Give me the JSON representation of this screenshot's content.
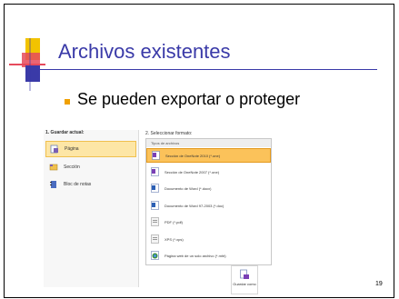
{
  "slide": {
    "title": "Archivos existentes",
    "bullet": "Se pueden exportar o proteger",
    "page_number": "19"
  },
  "dialog": {
    "left_header": "1. Guardar actual:",
    "left_items": [
      {
        "label": "Página",
        "icon": "page-icon",
        "selected": true
      },
      {
        "label": "Sección",
        "icon": "section-icon",
        "selected": false
      },
      {
        "label": "Bloc de notas",
        "icon": "notebook-icon",
        "selected": false
      }
    ],
    "right_header": "2. Seleccionar formato:",
    "list_header": "Tipos de archivos",
    "formats": [
      {
        "label": "Sección de OneNote 2010 (*.one)",
        "icon": "onenote-icon",
        "selected": true
      },
      {
        "label": "Sección de OneNote 2007 (*.one)",
        "icon": "onenote-icon",
        "selected": false
      },
      {
        "label": "Documento de Word (*.docx)",
        "icon": "word-icon",
        "selected": false
      },
      {
        "label": "Documento de Word 97-2003 (*.doc)",
        "icon": "word-icon",
        "selected": false
      },
      {
        "label": "PDF (*.pdf)",
        "icon": "pdf-icon",
        "selected": false
      },
      {
        "label": "XPS (*.xps)",
        "icon": "xps-icon",
        "selected": false
      },
      {
        "label": "Página web de un solo archivo (*.mht)",
        "icon": "web-icon",
        "selected": false
      }
    ],
    "save_button": "Guardar como"
  },
  "colors": {
    "title": "#3a3aa8",
    "accent": "#f0a000",
    "selected_format": "#fbc25a",
    "selected_left": "#fde6a6"
  }
}
